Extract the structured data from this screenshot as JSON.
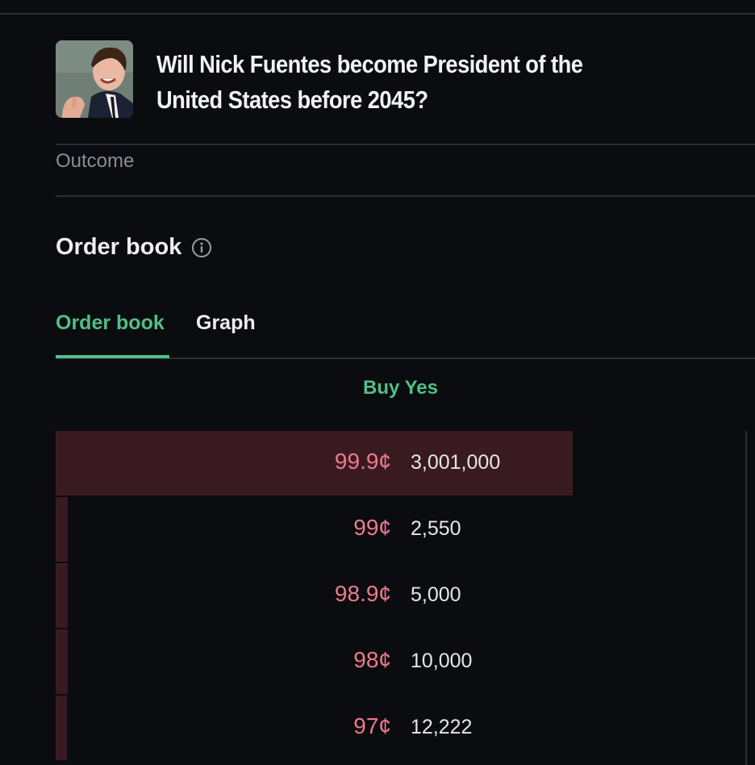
{
  "market": {
    "title": "Will Nick Fuentes become President of the United States before 2045?",
    "thumbnail": "portrait-photo"
  },
  "outcome_label": "Outcome",
  "order_book": {
    "heading": "Order book",
    "info_icon": "info-circle-icon",
    "tabs": [
      {
        "label": "Order book",
        "active": true
      },
      {
        "label": "Graph",
        "active": false
      }
    ],
    "side_label": "Buy Yes",
    "rows": [
      {
        "price": "99.9¢",
        "qty": "3,001,000",
        "depth": 0.745
      },
      {
        "price": "99¢",
        "qty": "2,550",
        "depth": 0.018
      },
      {
        "price": "98.9¢",
        "qty": "5,000",
        "depth": 0.018
      },
      {
        "price": "98¢",
        "qty": "10,000",
        "depth": 0.017
      },
      {
        "price": "97¢",
        "qty": "12,222",
        "depth": 0.014
      }
    ]
  },
  "colors": {
    "accent_green": "#4fbf87",
    "ask_red": "#ee7a8a",
    "depth_bar": "#3a1a21",
    "background": "#0b0c0f"
  }
}
